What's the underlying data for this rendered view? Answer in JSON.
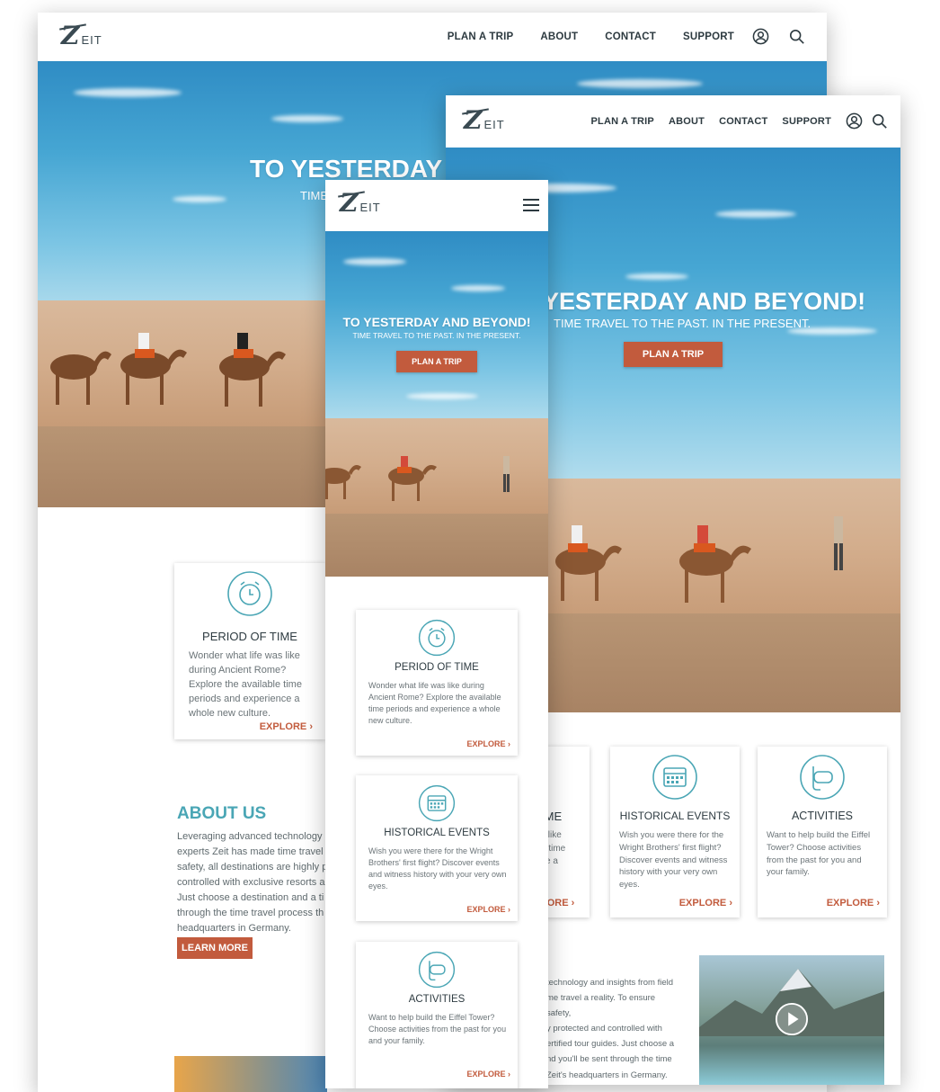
{
  "brand": {
    "logo_z": "Z",
    "logo_rest": "EIT"
  },
  "nav": {
    "plan_trip": "PLAN A TRIP",
    "about": "ABOUT",
    "contact": "CONTACT",
    "support": "SUPPORT",
    "account_icon": "user-circle-icon",
    "search_icon": "search-icon",
    "menu_icon": "hamburger-menu-icon"
  },
  "hero": {
    "title": "TO YESTERDAY AND BEYOND!",
    "subtitle": "TIME TRAVEL TO THE PAST. IN THE PRESENT.",
    "cta": "PLAN A TRIP"
  },
  "desktop_hero_partial": {
    "title": "TO YESTERDAY",
    "subtitle": "TIME",
    "tablet_title": "YESTERDAY AND BEYOND!",
    "tablet_subtitle": "TIME TRAVEL TO THE PAST. IN THE PRESENT."
  },
  "cards": [
    {
      "title": "PERIOD OF TIME",
      "icon": "alarm-clock-icon",
      "text": "Wonder what life was like during Ancient Rome? Explore the available time periods and experience a whole new culture.",
      "cta": "EXPLORE"
    },
    {
      "title": "HISTORICAL EVENTS",
      "icon": "calendar-icon",
      "text": "Wish you were there for the Wright Brothers' first flight? Discover events and witness history with your very own eyes.",
      "cta": "EXPLORE"
    },
    {
      "title": "ACTIVITIES",
      "icon": "snorkel-mask-icon",
      "text": "Want to help build the Eiffel Tower? Choose activities from the past for you and your family.",
      "cta": "EXPLORE"
    }
  ],
  "desktop_card": {
    "title": "PERIOD OF TIME",
    "text": "Wonder what life was like during Ancient Rome? Explore the available time periods and experience a whole new culture.",
    "cta": "EXPLORE"
  },
  "tablet_partial_card": {
    "title": "IME",
    "text_lines": [
      "s like",
      "e time",
      "ce a"
    ],
    "cta": "LORE"
  },
  "about": {
    "title": "ABOUT US",
    "lines": [
      "Leveraging advanced technology",
      "experts Zeit has made time travel",
      "safety, all destinations are highly p",
      "controlled with exclusive resorts a",
      "Just choose a destination and a ti",
      "through the time travel process th",
      "headquarters in Germany."
    ],
    "cta": "LEARN MORE"
  },
  "tablet_about_lines": [
    "technology and insights from field",
    "me travel a reality. To ensure safety,",
    "y protected and controlled with",
    "ertified tour guides. Just choose a",
    "nd you'll be sent through the time",
    "Zeit's headquarters in Germany."
  ],
  "video": {
    "play_icon": "play-button-icon"
  },
  "colors": {
    "accent": "#c25b3d",
    "teal": "#4aa6b5",
    "text_dark": "#2e3b41"
  }
}
